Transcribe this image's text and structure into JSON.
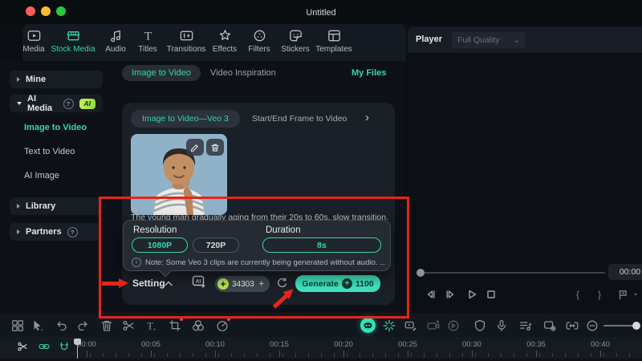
{
  "window": {
    "title": "Untitled"
  },
  "top_toolbar": {
    "items": [
      {
        "label": "Media"
      },
      {
        "label": "Stock Media",
        "active": true
      },
      {
        "label": "Audio"
      },
      {
        "label": "Titles"
      },
      {
        "label": "Transitions"
      },
      {
        "label": "Effects"
      },
      {
        "label": "Filters"
      },
      {
        "label": "Stickers"
      },
      {
        "label": "Templates"
      }
    ]
  },
  "player": {
    "label": "Player",
    "quality": "Full Quality",
    "time": "00:00",
    "brace_open": "{",
    "brace_close": "}"
  },
  "sidebar": {
    "items": [
      {
        "label": "Mine"
      },
      {
        "label": "AI Media",
        "badge": "AI"
      },
      {
        "label": "Image to Video",
        "active": true
      },
      {
        "label": "Text to Video"
      },
      {
        "label": "AI Image"
      },
      {
        "label": "Library"
      },
      {
        "label": "Partners"
      }
    ]
  },
  "content": {
    "tab_image_to_video": "Image to Video",
    "tab_video_inspiration": "Video Inspiration",
    "my_files": "My Files",
    "card": {
      "tab_veo": "Image to Video—Veo 3",
      "tab_frames": "Start/End Frame to Video",
      "chevron": "›",
      "prompt": "The young man gradually aging from their 20s to 60s, slow transition...",
      "resolution_label": "Resolution",
      "resolution_options": [
        "1080P",
        "720P"
      ],
      "duration_label": "Duration",
      "duration_value": "8s",
      "note": "Note: Some Veo 3 clips are currently being generated without audio. ...",
      "setting_label": "Setting",
      "credits_value": "34303",
      "credits_plus": "+",
      "generate_label": "Generate",
      "generate_cost": "1100"
    }
  },
  "timeline": {
    "ruler": [
      "00:00",
      "00:05",
      "00:10",
      "00:15",
      "00:20",
      "00:25",
      "00:30",
      "00:35",
      "00:40"
    ]
  },
  "icons": {
    "help": "?",
    "info": "i",
    "titles_glyph": "T",
    "text_tool_glyph": "T",
    "ai_glyph": "AI",
    "plus": "+",
    "chevron_down": "⌄"
  },
  "colors": {
    "accent": "#36d6ab",
    "generate_button": "#3ee3bd",
    "annotation_red": "#e5261b",
    "ai_badge_green": "#a6e34c"
  }
}
